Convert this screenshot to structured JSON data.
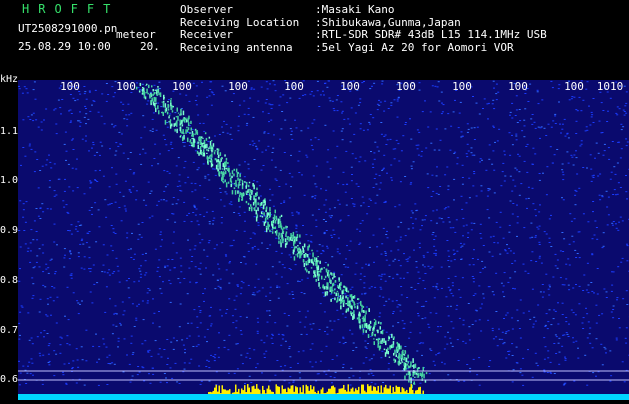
{
  "header": {
    "brand": "HROFFT",
    "filename": "UT2508291000.pn",
    "filename_sub": "meteor",
    "timestamp": "25.08.29 10:00",
    "timestamp_b": "20.",
    "meta": [
      {
        "key": "Observer",
        "value": ":Masaki Kano"
      },
      {
        "key": "Receiving Location",
        "value": ":Shibukawa,Gunma,Japan"
      },
      {
        "key": "Receiver",
        "value": ":RTL-SDR SDR# 43dB L15 114.1MHz USB"
      },
      {
        "key": "Receiving antenna",
        "value": ":5el Yagi Az 20 for Aomori VOR"
      }
    ]
  },
  "axis": {
    "freq_unit": "kHz",
    "y_labels": [
      "1.1",
      "1.0",
      "0.9",
      "0.8",
      "0.7",
      "0.6"
    ],
    "top_ticks": [
      "100",
      "100",
      "100",
      "100",
      "100",
      "100",
      "100",
      "100",
      "100",
      "100",
      "1010"
    ]
  },
  "colors": {
    "background": "#0a0a6e",
    "noise": "#1a3cff",
    "trail": "#44d0a0",
    "bottom_band": "#ffee00",
    "baseline": "#00d7ff",
    "grid": "#c0c0ff"
  }
}
